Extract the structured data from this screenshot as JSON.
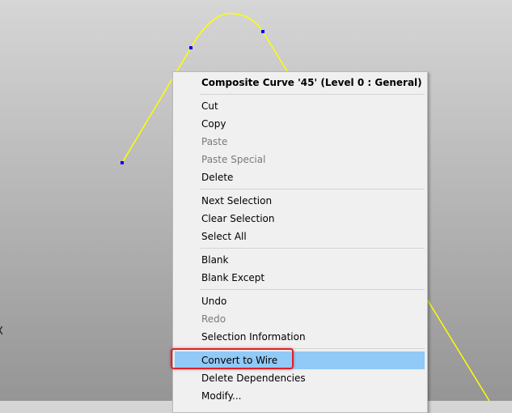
{
  "viewport": {
    "axis_label": "X",
    "curve_color": "#ffff00",
    "vertex_color": "#0000ff"
  },
  "context_menu": {
    "header": "Composite Curve '45' (Level 0 : General)",
    "groups": [
      [
        {
          "label": "Cut",
          "enabled": true
        },
        {
          "label": "Copy",
          "enabled": true
        },
        {
          "label": "Paste",
          "enabled": false
        },
        {
          "label": "Paste Special",
          "enabled": false
        },
        {
          "label": "Delete",
          "enabled": true
        }
      ],
      [
        {
          "label": "Next Selection",
          "enabled": true
        },
        {
          "label": "Clear Selection",
          "enabled": true
        },
        {
          "label": "Select All",
          "enabled": true
        }
      ],
      [
        {
          "label": "Blank",
          "enabled": true
        },
        {
          "label": "Blank Except",
          "enabled": true
        }
      ],
      [
        {
          "label": "Undo",
          "enabled": true
        },
        {
          "label": "Redo",
          "enabled": false
        },
        {
          "label": "Selection Information",
          "enabled": true
        }
      ],
      [
        {
          "label": "Convert to Wire",
          "enabled": true,
          "highlighted": true
        },
        {
          "label": "Delete Dependencies",
          "enabled": true
        },
        {
          "label": "Modify...",
          "enabled": true
        }
      ]
    ],
    "highlight_color": "#91c9f7",
    "annotation_color": "#e0202a"
  }
}
